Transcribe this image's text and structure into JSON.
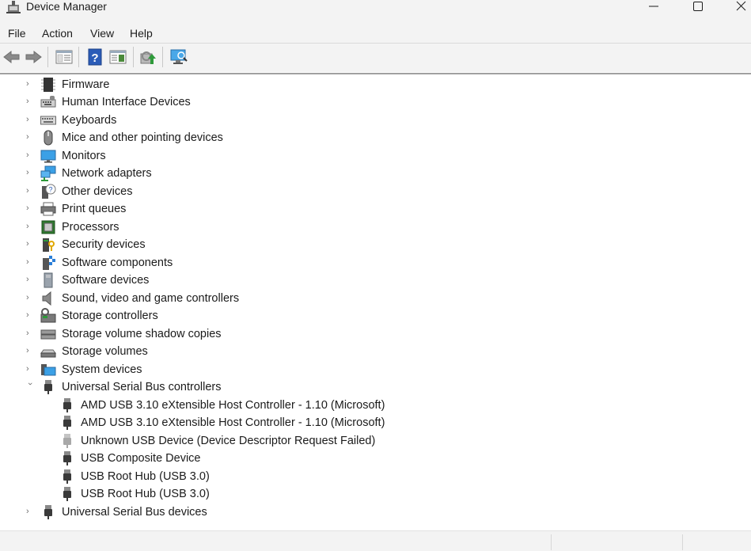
{
  "window": {
    "title": "Device Manager",
    "minimize": "—",
    "maximize": "☐",
    "close": "✕"
  },
  "menu": [
    "File",
    "Action",
    "View",
    "Help"
  ],
  "tree": {
    "categories": [
      {
        "label": "Firmware",
        "icon": "firmware-icon"
      },
      {
        "label": "Human Interface Devices",
        "icon": "hid-icon"
      },
      {
        "label": "Keyboards",
        "icon": "keyboard-icon"
      },
      {
        "label": "Mice and other pointing devices",
        "icon": "mouse-icon"
      },
      {
        "label": "Monitors",
        "icon": "monitor-icon"
      },
      {
        "label": "Network adapters",
        "icon": "network-adapter-icon"
      },
      {
        "label": "Other devices",
        "icon": "unknown-device-icon"
      },
      {
        "label": "Print queues",
        "icon": "printer-icon"
      },
      {
        "label": "Processors",
        "icon": "processor-icon"
      },
      {
        "label": "Security devices",
        "icon": "security-device-icon"
      },
      {
        "label": "Software components",
        "icon": "software-component-icon"
      },
      {
        "label": "Software devices",
        "icon": "software-device-icon"
      },
      {
        "label": "Sound, video and game controllers",
        "icon": "speaker-icon"
      },
      {
        "label": "Storage controllers",
        "icon": "storage-controller-icon"
      },
      {
        "label": "Storage volume shadow copies",
        "icon": "drive-icon"
      },
      {
        "label": "Storage volumes",
        "icon": "volume-icon"
      },
      {
        "label": "System devices",
        "icon": "system-folder-icon"
      },
      {
        "label": "Universal Serial Bus controllers",
        "icon": "usb-icon",
        "expanded": true
      },
      {
        "label": "Universal Serial Bus devices",
        "icon": "usb-icon"
      }
    ],
    "usb_children": [
      {
        "label": "AMD USB 3.10 eXtensible Host Controller - 1.10 (Microsoft)",
        "icon": "usb-icon"
      },
      {
        "label": "AMD USB 3.10 eXtensible Host Controller - 1.10 (Microsoft)",
        "icon": "usb-icon"
      },
      {
        "label": "Unknown USB Device (Device Descriptor Request Failed)",
        "icon": "usb-warning-icon",
        "disabled": true
      },
      {
        "label": "USB Composite Device",
        "icon": "usb-icon"
      },
      {
        "label": "USB Root Hub (USB 3.0)",
        "icon": "usb-icon"
      },
      {
        "label": "USB Root Hub (USB 3.0)",
        "icon": "usb-icon"
      }
    ]
  }
}
